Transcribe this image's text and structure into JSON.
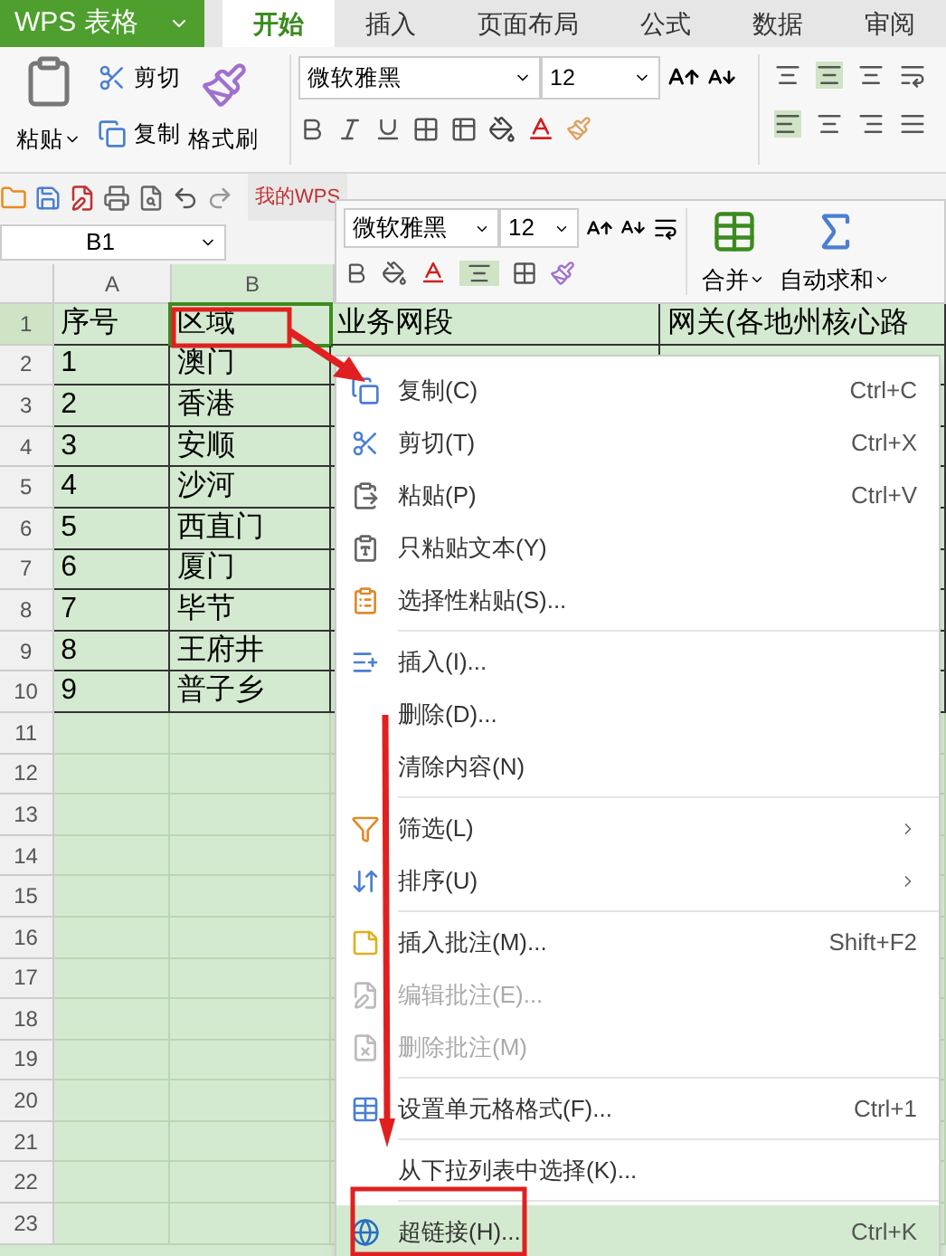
{
  "app_menu": {
    "label": "WPS 表格"
  },
  "tabs": [
    {
      "label": "开始",
      "selected": true
    },
    {
      "label": "插入",
      "selected": false
    },
    {
      "label": "页面布局",
      "selected": false
    },
    {
      "label": "公式",
      "selected": false
    },
    {
      "label": "数据",
      "selected": false
    },
    {
      "label": "审阅",
      "selected": false
    }
  ],
  "ribbon": {
    "paste": "粘贴",
    "cut": "剪切",
    "copy": "复制",
    "format_painter": "格式刷",
    "font": "微软雅黑",
    "font_size": "12"
  },
  "quick_access": {
    "my_wps": "我的WPS"
  },
  "name_box": "B1",
  "columns": [
    {
      "label": "A",
      "selected": false
    },
    {
      "label": "B",
      "selected": true
    }
  ],
  "rows": [
    {
      "number": "1",
      "selected": true,
      "cells": [
        "序号",
        "区域",
        "业务网段",
        "网关(各地州核心路"
      ]
    },
    {
      "number": "2",
      "selected": false,
      "cells": [
        "1",
        "澳门"
      ]
    },
    {
      "number": "3",
      "selected": false,
      "cells": [
        "2",
        "香港"
      ]
    },
    {
      "number": "4",
      "selected": false,
      "cells": [
        "3",
        "安顺"
      ]
    },
    {
      "number": "5",
      "selected": false,
      "cells": [
        "4",
        "沙河"
      ]
    },
    {
      "number": "6",
      "selected": false,
      "cells": [
        "5",
        "西直门"
      ]
    },
    {
      "number": "7",
      "selected": false,
      "cells": [
        "6",
        "厦门"
      ]
    },
    {
      "number": "8",
      "selected": false,
      "cells": [
        "7",
        "毕节"
      ]
    },
    {
      "number": "9",
      "selected": false,
      "cells": [
        "8",
        "王府井"
      ]
    },
    {
      "number": "10",
      "selected": false,
      "cells": [
        "9",
        "普子乡"
      ]
    },
    {
      "number": "11",
      "selected": false
    },
    {
      "number": "12",
      "selected": false
    },
    {
      "number": "13",
      "selected": false
    },
    {
      "number": "14",
      "selected": false
    },
    {
      "number": "15",
      "selected": false
    },
    {
      "number": "16",
      "selected": false
    },
    {
      "number": "17",
      "selected": false
    },
    {
      "number": "18",
      "selected": false
    },
    {
      "number": "19",
      "selected": false
    },
    {
      "number": "20",
      "selected": false
    },
    {
      "number": "21",
      "selected": false
    },
    {
      "number": "22",
      "selected": false
    },
    {
      "number": "23",
      "selected": false
    }
  ],
  "mini_toolbar": {
    "font": "微软雅黑",
    "font_size": "12",
    "merge": "合并",
    "autosum": "自动求和"
  },
  "context_menu": [
    {
      "kind": "item",
      "label": "复制(C)",
      "shortcut": "Ctrl+C",
      "disabled": false,
      "submenu": false,
      "highlighted": false
    },
    {
      "kind": "item",
      "label": "剪切(T)",
      "shortcut": "Ctrl+X",
      "disabled": false,
      "submenu": false,
      "highlighted": false
    },
    {
      "kind": "item",
      "label": "粘贴(P)",
      "shortcut": "Ctrl+V",
      "disabled": false,
      "submenu": false,
      "highlighted": false
    },
    {
      "kind": "item",
      "label": "只粘贴文本(Y)",
      "disabled": false,
      "submenu": false,
      "highlighted": false
    },
    {
      "kind": "item",
      "label": "选择性粘贴(S)...",
      "disabled": false,
      "submenu": false,
      "highlighted": false
    },
    {
      "kind": "separator"
    },
    {
      "kind": "item",
      "label": "插入(I)...",
      "disabled": false,
      "submenu": false,
      "highlighted": false
    },
    {
      "kind": "item",
      "label": "删除(D)...",
      "disabled": false,
      "submenu": false,
      "highlighted": false
    },
    {
      "kind": "item",
      "label": "清除内容(N)",
      "disabled": false,
      "submenu": false,
      "highlighted": false
    },
    {
      "kind": "separator"
    },
    {
      "kind": "item",
      "label": "筛选(L)",
      "disabled": false,
      "submenu": true,
      "highlighted": false
    },
    {
      "kind": "item",
      "label": "排序(U)",
      "disabled": false,
      "submenu": true,
      "highlighted": false
    },
    {
      "kind": "separator"
    },
    {
      "kind": "item",
      "label": "插入批注(M)...",
      "shortcut": "Shift+F2",
      "disabled": false,
      "submenu": false,
      "highlighted": false
    },
    {
      "kind": "item",
      "label": "编辑批注(E)...",
      "disabled": true,
      "submenu": false,
      "highlighted": false
    },
    {
      "kind": "item",
      "label": "删除批注(M)",
      "disabled": true,
      "submenu": false,
      "highlighted": false
    },
    {
      "kind": "separator"
    },
    {
      "kind": "item",
      "label": "设置单元格格式(F)...",
      "shortcut": "Ctrl+1",
      "disabled": false,
      "submenu": false,
      "highlighted": false
    },
    {
      "kind": "separator"
    },
    {
      "kind": "item",
      "label": "从下拉列表中选择(K)...",
      "disabled": false,
      "submenu": false,
      "highlighted": false
    },
    {
      "kind": "separator"
    },
    {
      "kind": "item",
      "label": "超链接(H)...",
      "shortcut": "Ctrl+K",
      "disabled": false,
      "submenu": false,
      "highlighted": true
    }
  ]
}
